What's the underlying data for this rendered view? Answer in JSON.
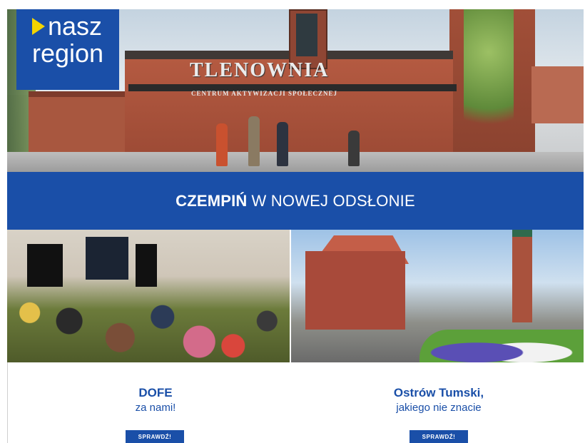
{
  "logo": {
    "line1": "nasz",
    "line2": "region"
  },
  "hero": {
    "sign": "TLENOWNIA",
    "subsign": "CENTRUM AKTYWIZACJI SPOŁECZNEJ"
  },
  "banner": {
    "bold": "CZEMPIŃ",
    "rest": "W NOWEJ ODSŁONIE"
  },
  "cards": [
    {
      "title": "DOFE",
      "subtitle": "za nami!",
      "button": "SPRAWDŹ!"
    },
    {
      "title": "Ostrów Tumski,",
      "subtitle": "jakiego nie znacie",
      "button": "SPRAWDŹ!"
    }
  ],
  "colors": {
    "brand_blue": "#1a4fa8",
    "logo_accent": "#f3d400"
  }
}
